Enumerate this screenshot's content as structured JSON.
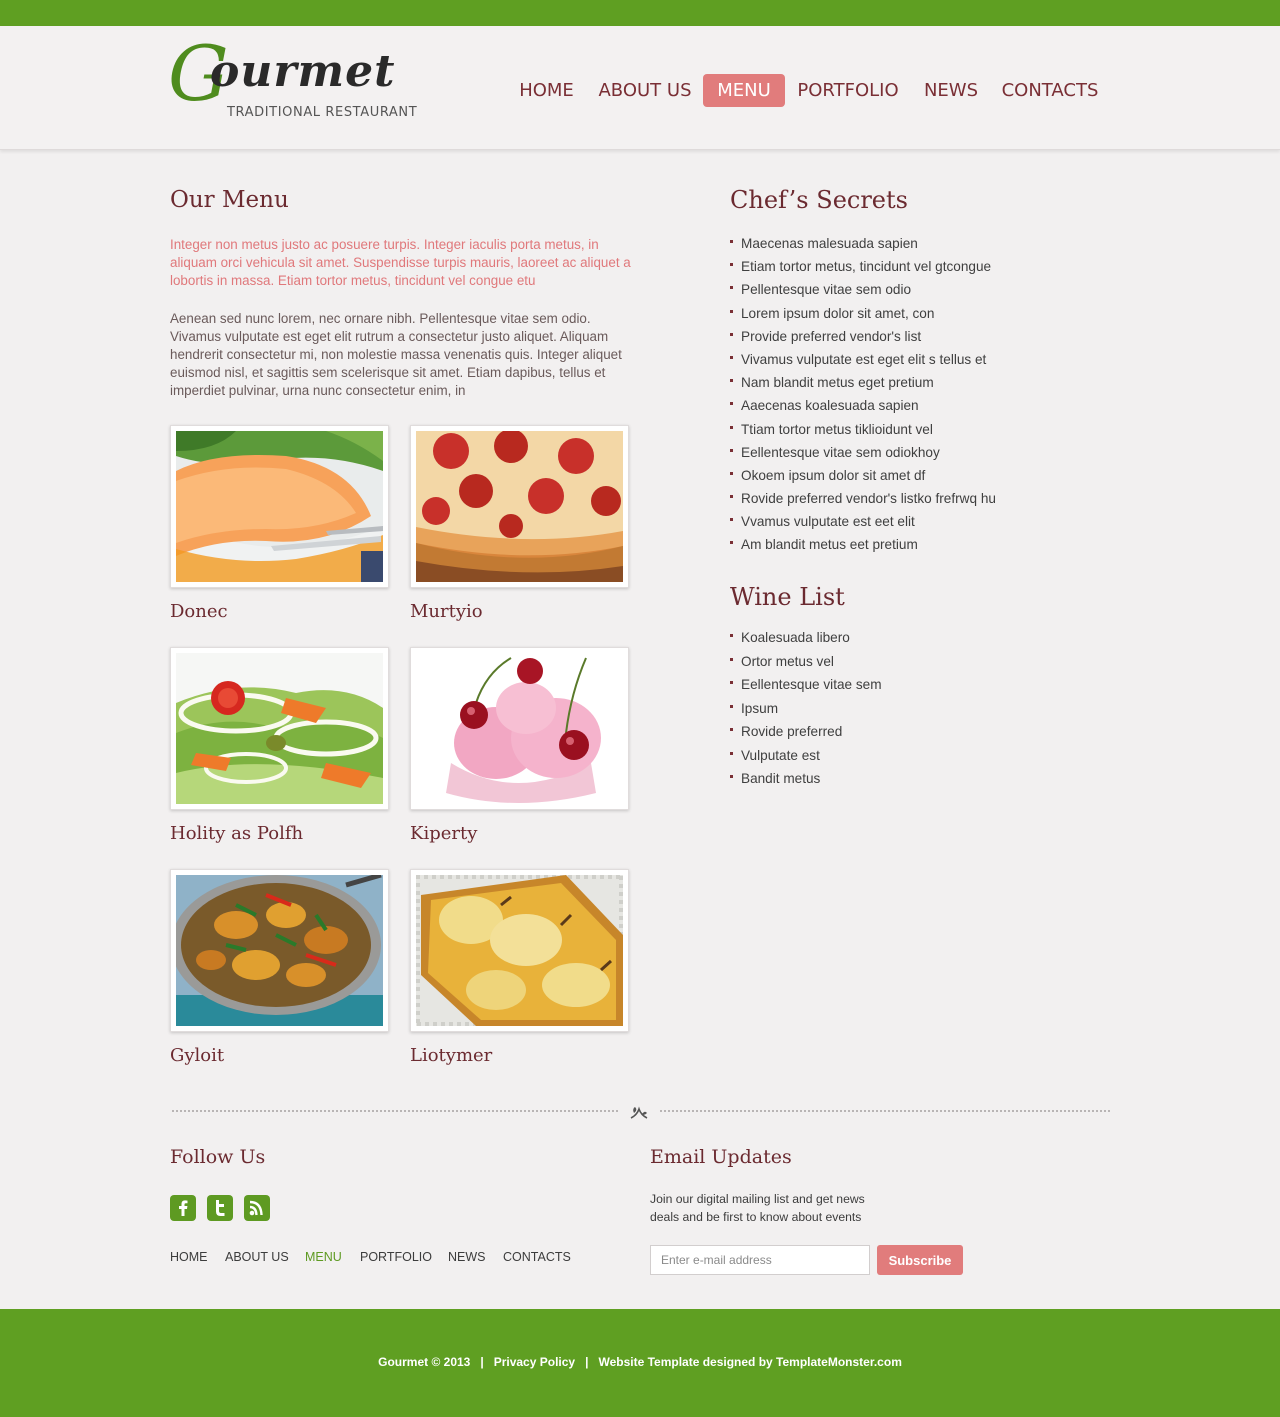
{
  "colors": {
    "green": "#5f9f22",
    "accent_pink": "#e17c7c",
    "heading_maroon": "#6b2a30",
    "background": "#f2f0f0"
  },
  "brand": {
    "logo_initial": "G",
    "logo_rest": "ourmet",
    "tagline": "TRADITIONAL RESTAURANT"
  },
  "nav": {
    "items": [
      {
        "label": "HOME"
      },
      {
        "label": "ABOUT US"
      },
      {
        "label": "MENU",
        "active": true
      },
      {
        "label": "PORTFOLIO"
      },
      {
        "label": "NEWS"
      },
      {
        "label": "CONTACTS"
      }
    ]
  },
  "menu": {
    "title": "Our Menu",
    "intro_accent": "Integer non metus justo ac posuere turpis. Integer iaculis porta metus, in aliquam orci vehicula sit amet. Suspendisse turpis mauris, laoreet ac aliquet a lobortis in massa. Etiam tortor metus, tincidunt vel congue etu",
    "intro_body": "Aenean sed nunc lorem, nec ornare nibh. Pellentesque vitae sem odio. Vivamus vulputate est eget elit rutrum a consectetur justo aliquet. Aliquam hendrerit consectetur mi, non molestie massa venenatis quis. Integer aliquet euismod nisl, et sagittis sem scelerisque sit amet. Etiam dapibus, tellus et imperdiet pulvinar, urna nunc consectetur enim, in",
    "items": [
      {
        "title": "Donec",
        "image": "melon-dessert"
      },
      {
        "title": "Murtyio",
        "image": "pepperoni-pizza"
      },
      {
        "title": "Holity as Polfh",
        "image": "fresh-salad"
      },
      {
        "title": "Kiperty",
        "image": "cherry-ice-cream"
      },
      {
        "title": "Gyloit",
        "image": "curry-dish"
      },
      {
        "title": "Liotymer",
        "image": "pear-tart"
      }
    ]
  },
  "chef": {
    "title": "Chef’s Secrets",
    "items": [
      "Maecenas malesuada sapien",
      "Etiam tortor metus, tincidunt vel gtcongue",
      "Pellentesque vitae sem odio",
      "Lorem ipsum dolor sit amet, con",
      "Provide preferred vendor's list",
      "Vivamus vulputate est eget elit s tellus et",
      "Nam blandit metus eget pretium",
      "Aaecenas koalesuada sapien",
      "Ttiam tortor metus tiklioidunt vel",
      "Eellentesque vitae sem odiokhoy",
      "Okoem ipsum dolor sit amet df",
      "Rovide preferred vendor's listko frefrwq hu",
      "Vvamus vulputate est eet elit",
      "Am blandit metus eet pretium"
    ]
  },
  "wine": {
    "title": "Wine List",
    "items": [
      "Koalesuada libero",
      "Ortor metus vel",
      "Eellentesque vitae sem",
      "Ipsum",
      "Rovide preferred",
      "Vulputate est",
      "Bandit metus"
    ]
  },
  "follow": {
    "title": "Follow Us",
    "icons": [
      "facebook-icon",
      "twitter-icon",
      "rss-icon"
    ]
  },
  "footer_nav": {
    "items": [
      {
        "label": "HOME"
      },
      {
        "label": "ABOUT US"
      },
      {
        "label": "MENU",
        "active": true
      },
      {
        "label": "PORTFOLIO"
      },
      {
        "label": "NEWS"
      },
      {
        "label": "CONTACTS"
      }
    ]
  },
  "email": {
    "title": "Email Updates",
    "text": "Join our digital mailing list and get news deals and be first to know about events",
    "placeholder": "Enter e-mail address",
    "button": "Subscribe"
  },
  "footer": {
    "copyright": "Gourmet © 2013",
    "separator": "|",
    "privacy": "Privacy Policy",
    "credit": "Website Template designed by TemplateMonster.com"
  }
}
